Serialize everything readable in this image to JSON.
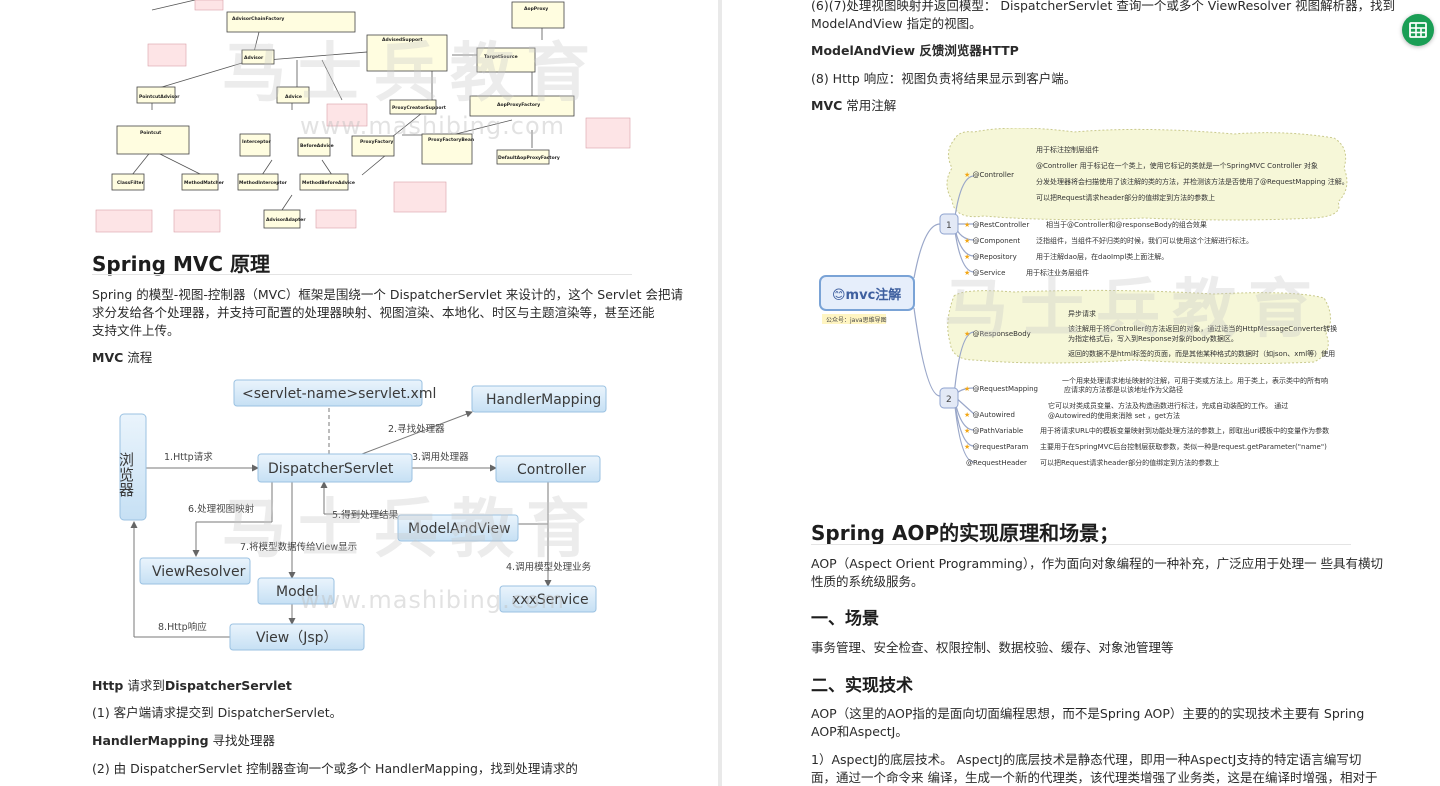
{
  "watermark": {
    "text": "马士兵教育",
    "url": "www.mashibing.com"
  },
  "left": {
    "uml": {
      "classes": [
        "AdvisorChainFactory",
        "AdvisedSupport",
        "TargetSource",
        "Advisor",
        "PointcutAdvisor",
        "Advice",
        "ProxyCreatorSupport",
        "AopProxyFactory",
        "Pointcut",
        "Interceptor",
        "BeforeAdvice",
        "ProxyFactory",
        "ProxyFactoryBean",
        "DefaultAopProxyFactory",
        "ClassFilter",
        "MethodMatcher",
        "MethodInterceptor",
        "MethodBeforeAdvice",
        "AdvisorAdapter",
        "AopProxy"
      ]
    },
    "title": "Spring MVC 原理",
    "intro": [
      "Spring 的模型-视图-控制器（MVC）框架是围绕一个 DispatcherServlet 来设计的，这个 Servlet 会把请",
      "求分发给各个处理器，并支持可配置的处理器映射、视图渲染、本地化、时区与主题渲染等，甚至还能",
      "支持文件上传。"
    ],
    "flow_heading_bold": "MVC",
    "flow_heading_rest": " 流程",
    "diagram": {
      "browser": "浏览器",
      "servlet_xml": "<servlet-name>servlet.xml",
      "handler_mapping": "HandlerMapping",
      "dispatcher": "DispatcherServlet",
      "controller": "Controller",
      "model_and_view": "ModelAndView",
      "view_resolver": "ViewResolver",
      "model": "Model",
      "xxx_service": "xxxService",
      "view": "View（Jsp）",
      "e1": "1.Http请求",
      "e2": "2.寻找处理器",
      "e3": "3.调用处理器",
      "e4": "4.调用模型处理业务",
      "e5": "5.得到处理结果",
      "e6": "6.处理视图映射",
      "e7": "7.将模型数据传给View显示",
      "e8": "8.Http响应"
    },
    "p1_bold": "Http",
    "p1_mid": " 请求到",
    "p1_bold2": "DispatcherServlet",
    "p2": "(1) 客户端请求提交到 DispatcherServlet。",
    "p3_bold": "HandlerMapping",
    "p3_rest": " 寻找处理器",
    "p4": "(2) 由 DispatcherServlet 控制器查询一个或多个 HandlerMapping，找到处理请求的"
  },
  "right": {
    "p1": "(6)(7)处理视图映射并返回模型： DispatcherServlet 查询一个或多个 ViewResolver 视图解析器，找到",
    "p1b": "ModelAndView 指定的视图。",
    "p2_bold": "ModelAndView",
    "p2_rest": " 反馈浏览器HTTP",
    "p3": "(8) Http 响应：视图负责将结果显示到客户端。",
    "p4_bold": "MVC",
    "p4_rest": " 常用注解",
    "mindmap": {
      "root": "😊mvc注解",
      "root_sub": "公众号：java思维导图",
      "n1": "1",
      "n2": "2",
      "controller": "@Controller",
      "controller_notes": [
        "用于标注控制层组件",
        "@Controller 用于标记在一个类上，使用它标记的类就是一个SpringMVC Controller 对象",
        "分发处理器将会扫描使用了该注解的类的方法，并检测该方法是否使用了@RequestMapping 注解。",
        "可以把Request请求header部分的值绑定到方法的参数上"
      ],
      "rest_controller": "@RestController",
      "rest_controller_note": "相当于@Controller和@responseBody的组合效果",
      "component": "@Component",
      "component_note": "泛指组件，当组件不好归类的时候，我们可以使用这个注解进行标注。",
      "repository": "@Repository",
      "repository_note": "用于注解dao层，在daoImpl类上面注解。",
      "service": "@Service",
      "service_note": "用于标注业务层组件",
      "response_body": "@ResponseBody",
      "response_body_notes": [
        "异步请求",
        "该注解用于将Controller的方法返回的对象，通过适当的HttpMessageConverter转换",
        "为指定格式后，写入到Response对象的body数据区。",
        "返回的数据不是html标签的页面，而是其他某种格式的数据时（如json、xml等）使用"
      ],
      "request_mapping": "@RequestMapping",
      "request_mapping_notes": [
        "一个用来处理请求地址映射的注解，可用于类或方法上。用于类上，表示类中的所有响",
        "应请求的方法都是以该地址作为父路径"
      ],
      "autowired": "@Autowired",
      "autowired_notes": [
        "它可以对类成员变量、方法及构造函数进行标注，完成自动装配的工作。 通过",
        "@Autowired的使用来消除 set ，get方法"
      ],
      "path_variable": "@PathVariable",
      "path_variable_note": "用于将请求URL中的模板变量映射到功能处理方法的参数上，即取出uri模板中的变量作为参数",
      "request_param": "@requestParam",
      "request_param_note": "主要用于在SpringMVC后台控制层获取参数，类似一种是request.getParameter(\"name\")",
      "request_header": "@RequestHeader",
      "request_header_note": "可以把Request请求header部分的值绑定到方法的参数上"
    },
    "aop_title": "Spring AOP的实现原理和场景；",
    "aop_intro": [
      "AOP（Aspect Orient Programming），作为面向对象编程的一种补充，广泛应用于处理一 些具有横切",
      "性质的系统级服务。"
    ],
    "s1_title": "一、场景",
    "s1_text": "事务管理、安全检查、权限控制、数据校验、缓存、对象池管理等",
    "s2_title": "二、实现技术",
    "s2_text": [
      "AOP（这里的AOP指的是面向切面编程思想，而不是Spring AOP）主要的的实现技术主要有 Spring",
      "AOP和AspectJ。"
    ],
    "s2_p2": [
      "1）AspectJ的底层技术。    AspectJ的底层技术是静态代理，即用一种AspectJ支持的特定语言编写切",
      "面，通过一个命令来 编译，生成一个新的代理类，该代理类增强了业务类，这是在编译时增强，相对于"
    ]
  },
  "colors": {
    "fab": "#1a9e55",
    "node_border": "#7aa3d6",
    "cloud_fill": "#f6f7d8",
    "mindmap_line": "#9aa7c9",
    "star": "#f3a715"
  }
}
